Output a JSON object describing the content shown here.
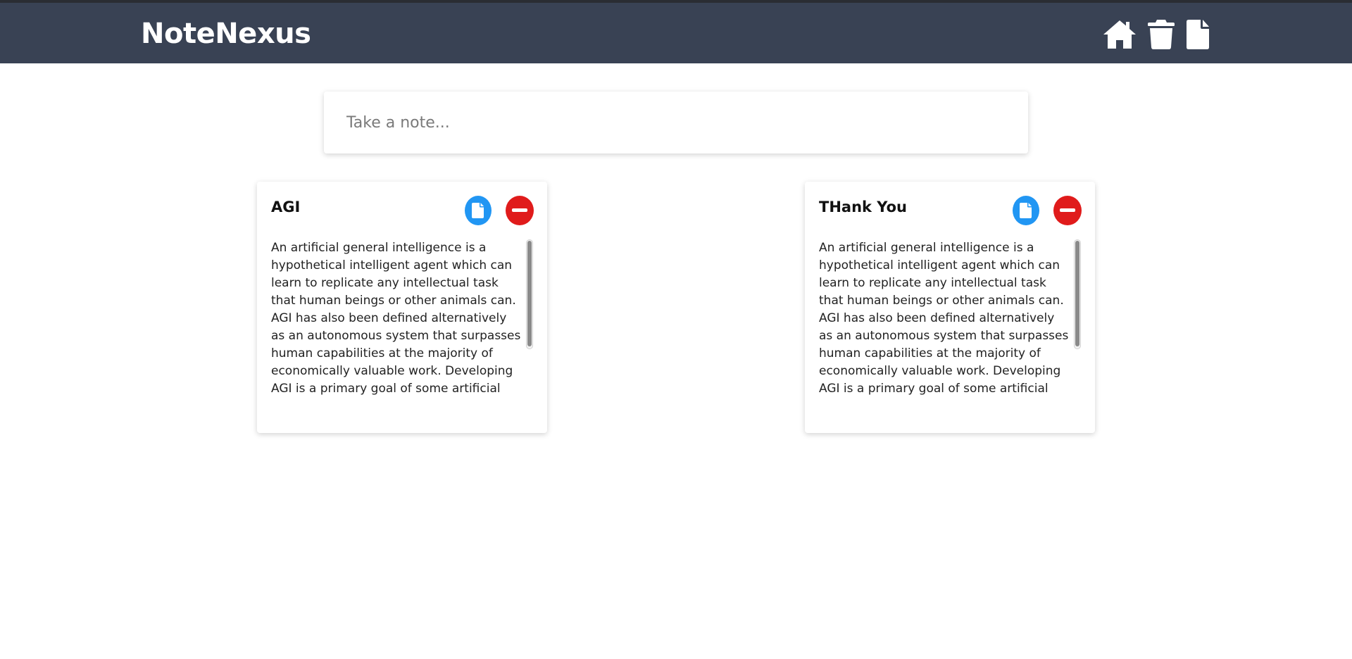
{
  "app": {
    "title": "NoteNexus"
  },
  "nav": {
    "icons": [
      "home-icon",
      "trash-icon",
      "file-icon"
    ]
  },
  "composer": {
    "placeholder": "Take a note...",
    "value": ""
  },
  "notes": [
    {
      "title": "AGI",
      "body": "An artificial general intelligence is a hypothetical intelligent agent which can learn to replicate any intellectual task that human beings or other animals can. AGI has also been defined alternatively as an autonomous system that surpasses human capabilities at the majority of economically valuable work. Developing AGI is a primary goal of some artificial"
    },
    {
      "title": "THank You",
      "body": "An artificial general intelligence is a hypothetical intelligent agent which can learn to replicate any intellectual task that human beings or other animals can. AGI has also been defined alternatively as an autonomous system that surpasses human capabilities at the majority of economically valuable work. Developing AGI is a primary goal of some artificial"
    }
  ],
  "colors": {
    "header_bg": "#394254",
    "save_button": "#2196f3",
    "delete_button": "#e01b1b"
  }
}
